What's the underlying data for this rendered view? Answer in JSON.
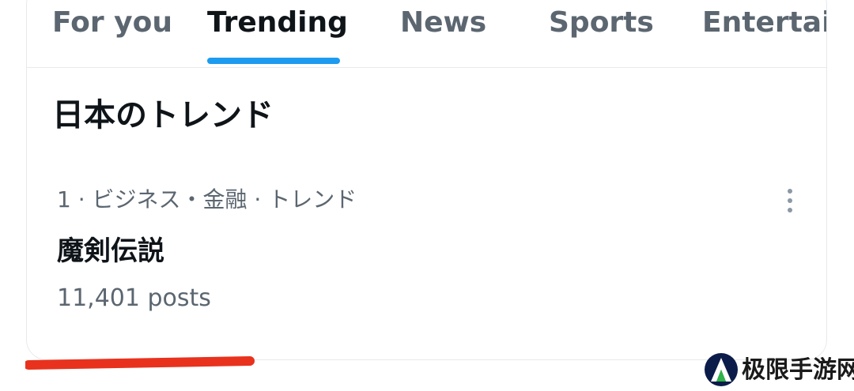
{
  "tabs": [
    {
      "label": "For you",
      "active": false
    },
    {
      "label": "Trending",
      "active": true
    },
    {
      "label": "News",
      "active": false
    },
    {
      "label": "Sports",
      "active": false
    },
    {
      "label": "Entertain",
      "active": false
    }
  ],
  "section": {
    "title": "日本のトレンド"
  },
  "trend": {
    "meta": "1 · ビジネス・金融 · トレンド",
    "name": "魔剣伝説",
    "count": "11,401 posts",
    "more_icon": "more-vertical-icon"
  },
  "watermark": {
    "text": "极限手游网",
    "logo_icon": "mountain-logo-icon"
  },
  "colors": {
    "accent": "#1d9bf0",
    "text_primary": "#0f1419",
    "text_secondary": "#5b6670",
    "annotation": "#e8321e",
    "divider": "#e7e9ec"
  }
}
